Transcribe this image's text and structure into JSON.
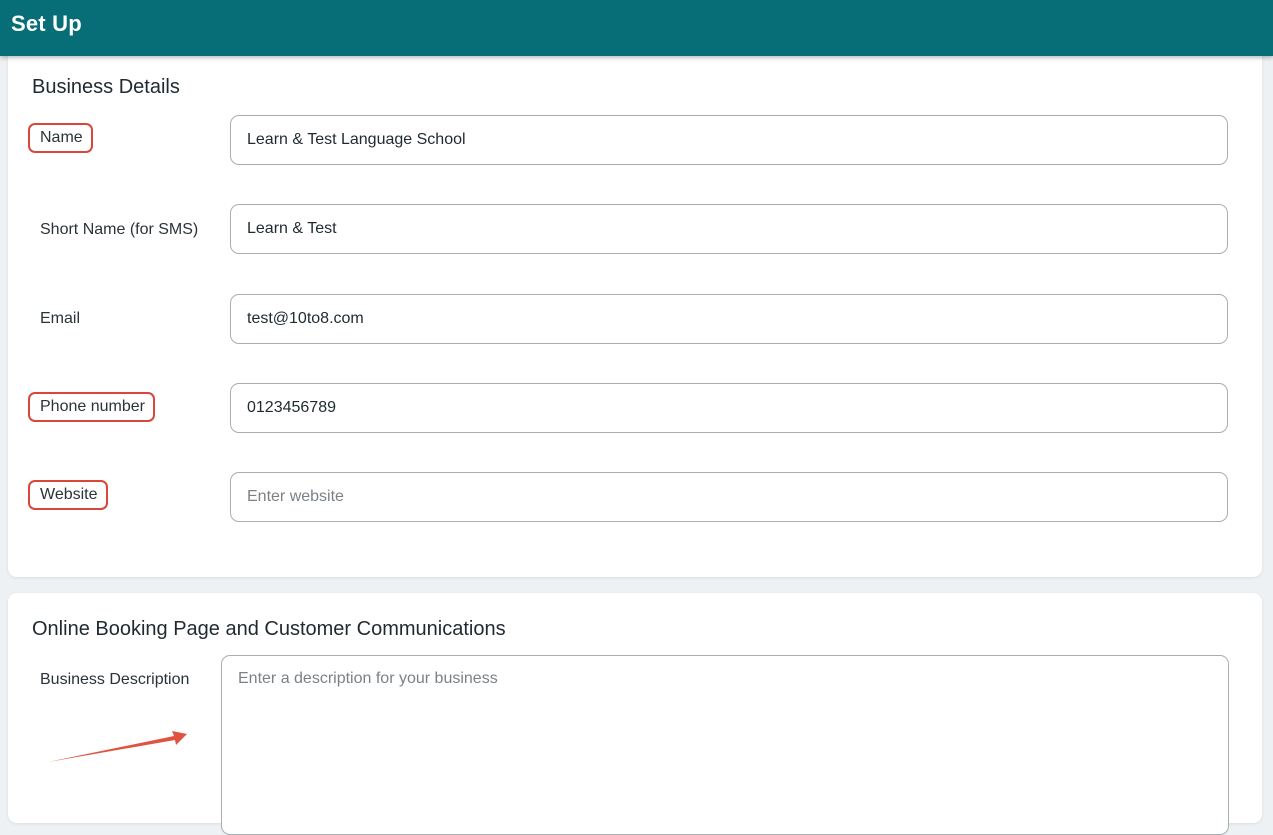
{
  "header": {
    "title": "Set Up"
  },
  "business_details": {
    "heading": "Business Details",
    "fields": [
      {
        "label": "Name",
        "value": "Learn & Test Language School",
        "placeholder": ""
      },
      {
        "label": "Short Name (for SMS)",
        "value": "Learn & Test",
        "placeholder": ""
      },
      {
        "label": "Email",
        "value": "test@10to8.com",
        "placeholder": ""
      },
      {
        "label": "Phone number",
        "value": "0123456789",
        "placeholder": ""
      },
      {
        "label": "Website",
        "value": "",
        "placeholder": "Enter website"
      }
    ]
  },
  "booking": {
    "heading": "Online Booking Page and Customer Communications",
    "description_label": "Business Description",
    "description_placeholder": "Enter a description for your business",
    "description_value": ""
  },
  "annotations": {
    "highlight_color": "#d9473a",
    "highlighted_fields": [
      "Name",
      "Phone number",
      "Website"
    ],
    "arrow_target": "Business Description"
  },
  "colors": {
    "header_bg": "#076e78",
    "page_bg": "#eef1f3",
    "card_bg": "#ffffff",
    "input_border": "#a9aeb2"
  }
}
